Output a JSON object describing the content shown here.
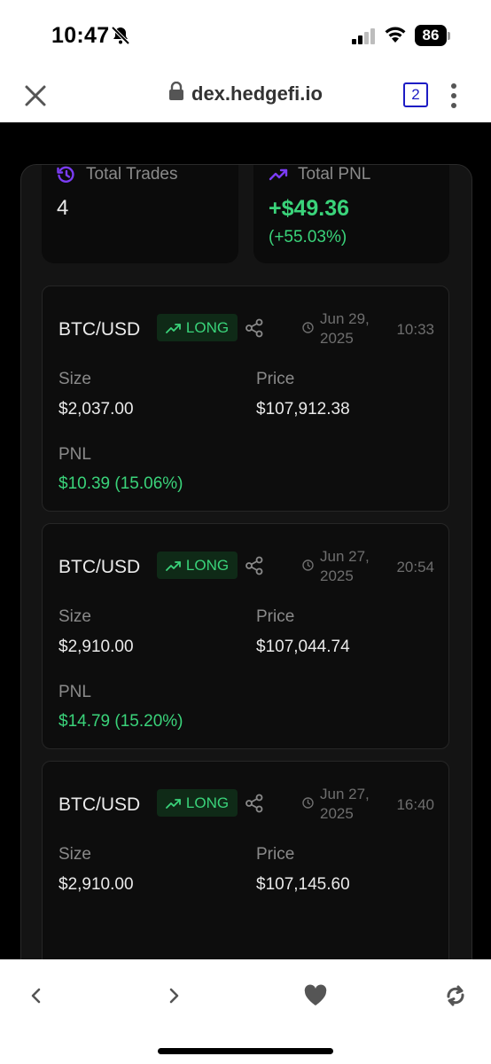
{
  "status": {
    "time": "10:47",
    "battery": "86"
  },
  "browser": {
    "url": "dex.hedgefi.io",
    "tab_count": "2"
  },
  "stats": {
    "total_trades_label": "Total Trades",
    "total_trades_value": "4",
    "total_pnl_label": "Total PNL",
    "total_pnl_value": "+$49.36",
    "total_pnl_percent": "(+55.03%)"
  },
  "labels": {
    "size": "Size",
    "price": "Price",
    "pnl": "PNL"
  },
  "trades": [
    {
      "pair": "BTC/USD",
      "side": "LONG",
      "date_line1": "Jun 29,",
      "date_line2": "2025",
      "time": "10:33",
      "size": "$2,037.00",
      "price": "$107,912.38",
      "pnl": "$10.39 (15.06%)"
    },
    {
      "pair": "BTC/USD",
      "side": "LONG",
      "date_line1": "Jun 27,",
      "date_line2": "2025",
      "time": "20:54",
      "size": "$2,910.00",
      "price": "$107,044.74",
      "pnl": "$14.79 (15.20%)"
    },
    {
      "pair": "BTC/USD",
      "side": "LONG",
      "date_line1": "Jun 27,",
      "date_line2": "2025",
      "time": "16:40",
      "size": "$2,910.00",
      "price": "$107,145.60",
      "pnl": ""
    }
  ],
  "colors": {
    "accent_green": "#3ad37a",
    "accent_purple": "#7b3cf5",
    "badge_bg": "#0f2a17"
  }
}
